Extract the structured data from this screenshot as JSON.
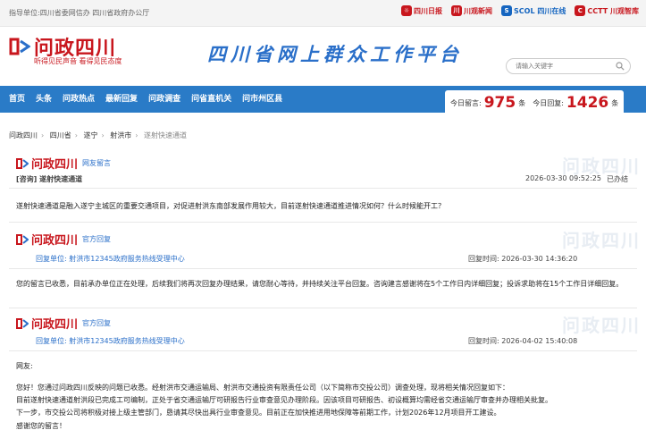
{
  "topbar": {
    "guide": "指导单位:四川省委网信办   四川省政府办公厅",
    "partners": [
      "四川日报",
      "川观新闻",
      "SCOL 四川在线",
      "CCTT 川观智库"
    ]
  },
  "header": {
    "logo": "问政四川",
    "slogan": "听得见民声音   看得见民态度",
    "platform_title": "四川省网上群众工作平台",
    "search_placeholder": "请输入关键字"
  },
  "nav": {
    "items": [
      "首页",
      "头条",
      "问政热点",
      "最新回复",
      "问政调查",
      "问省直机关",
      "问市州区县"
    ]
  },
  "stats": {
    "today_messages_label": "今日留言:",
    "today_messages": "975",
    "today_replies_label": "今日回复:",
    "today_replies": "1426",
    "unit": "条"
  },
  "breadcrumb": [
    "问政四川",
    "四川省",
    "遂宁",
    "射洪市",
    "遂射快速通道"
  ],
  "message": {
    "brand": "问政四川",
    "tag": "网友留言",
    "subject": "[咨询] 遂射快速通道",
    "datetime": "2026-03-30 09:52:25",
    "status": "已办结",
    "content": "遂射快速通道是融入遂宁主城区的重要交通项目，对促进射洪东南部发展作用较大，目前遂射快速通道推进情况如何？什么时候能开工？"
  },
  "reply1": {
    "brand": "问政四川",
    "tag": "官方回复",
    "unit_label": "回复单位:",
    "unit": "射洪市12345政府服务热线受理中心",
    "time_label": "回复时间:",
    "datetime": "2026-03-30 14:36:20",
    "content": "您的留言已收悉，目前承办单位正在处理，后续我们将再次回复办理结果，请您耐心等待，并持续关注平台回复。咨询建言感谢将在5个工作日内详细回复；投诉求助将在15个工作日详细回复。"
  },
  "reply2": {
    "brand": "问政四川",
    "tag": "官方回复",
    "unit_label": "回复单位:",
    "unit": "射洪市12345政府服务热线受理中心",
    "time_label": "回复时间:",
    "datetime": "2026-04-02 15:40:08",
    "greeting": "网友:",
    "paragraphs": [
      "您好！您通过问政四川反映的问题已收悉。经射洪市交通运输局、射洪市交通投资有限责任公司（以下简称市交投公司）调查处理，现将相关情况回复如下：",
      "目前遂射快速通道射洪段已完成工可编制，正处于省交通运输厅可研报告行业审查意见办理阶段。因该项目可研报告、初设概算均需经省交通运输厅审查并办理相关批复。",
      "下一步，市交投公司将积极对接上级主管部门，恳请其尽快出具行业审查意见。目前正在加快推进用地保障等前期工作，计划2026年12月项目开工建设。",
      "感谢您的留言！"
    ]
  },
  "watermark": "问政四川",
  "colors": {
    "brand_red": "#c8161d",
    "nav_blue": "#2a7bc7",
    "link_blue": "#2a6fc9"
  }
}
